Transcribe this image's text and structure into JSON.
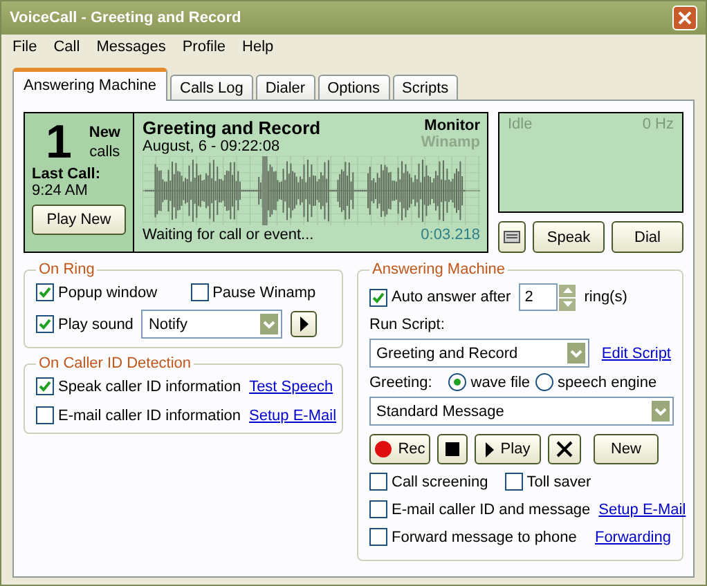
{
  "window": {
    "title": "VoiceCall - Greeting and Record"
  },
  "menu": [
    "File",
    "Call",
    "Messages",
    "Profile",
    "Help"
  ],
  "tabs": [
    {
      "label": "Answering Machine",
      "selected": true
    },
    {
      "label": "Calls Log",
      "selected": false
    },
    {
      "label": "Dialer",
      "selected": false
    },
    {
      "label": "Options",
      "selected": false
    },
    {
      "label": "Scripts",
      "selected": false
    }
  ],
  "display": {
    "count": "1",
    "count_label": [
      "New",
      "calls"
    ],
    "last_call_label": "Last Call:",
    "last_call_time": "9:24 AM",
    "play_button": "Play New",
    "script_title": "Greeting and Record",
    "date": "August, 6 - 09:22:08",
    "monitor": {
      "label": "Monitor",
      "active": true
    },
    "winamp": {
      "label": "Winamp",
      "active": false
    },
    "status": "Waiting for call or event...",
    "timer": "0:03.218"
  },
  "spectrum": {
    "status": "Idle",
    "frequency": "0 Hz"
  },
  "action_buttons": [
    "Speak",
    "Dial"
  ],
  "on_ring": {
    "title": "On Ring",
    "popup": {
      "label": "Popup window",
      "checked": true
    },
    "pause_winamp": {
      "label": "Pause Winamp",
      "checked": false
    },
    "play_sound": {
      "label": "Play sound",
      "checked": true
    },
    "sound": "Notify"
  },
  "caller_id": {
    "title": "On Caller ID Detection",
    "rows": [
      {
        "label": "Speak caller ID information",
        "checked": true,
        "link": "Test Speech"
      },
      {
        "label": "E-mail caller ID information",
        "checked": false,
        "link": "Setup E-Mail"
      }
    ]
  },
  "answering_machine": {
    "title": "Answering Machine",
    "auto_answer": {
      "label": "Auto answer after",
      "checked": true
    },
    "rings": "2",
    "rings_label": "ring(s)",
    "run_script_label": "Run Script:",
    "script": "Greeting and Record",
    "edit_link": "Edit Script",
    "greeting_label": "Greeting:",
    "greeting_options": [
      {
        "label": "wave file",
        "selected": true
      },
      {
        "label": "speech engine",
        "selected": false
      }
    ],
    "message": "Standard Message",
    "buttons": [
      {
        "kind": "record",
        "label": "Rec"
      },
      {
        "kind": "stop"
      },
      {
        "kind": "play",
        "label": "Play"
      },
      {
        "kind": "delete"
      },
      {
        "kind": "new",
        "label": "New"
      }
    ],
    "call_screening": {
      "label": "Call screening",
      "checked": false
    },
    "toll_saver": {
      "label": "Toll saver",
      "checked": false
    },
    "rows": [
      {
        "label": "E-mail caller ID and message",
        "checked": false,
        "link": "Setup E-Mail"
      },
      {
        "label": "Forward message to phone",
        "checked": false,
        "link": "Forwarding"
      }
    ]
  }
}
